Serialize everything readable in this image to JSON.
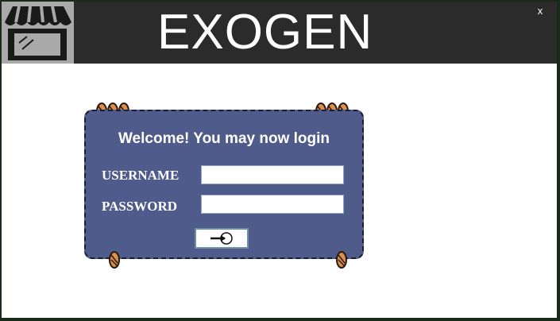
{
  "app": {
    "title": "EXOGEN",
    "close_label": "x",
    "logo_icon": "storefront-icon"
  },
  "login": {
    "welcome": "Welcome! You may now login",
    "username_label": "USERNAME",
    "username_value": "",
    "password_label": "PASSWORD",
    "password_value": "",
    "submit_icon": "login-arrow-icon"
  },
  "colors": {
    "header_bg": "#2b2b2b",
    "logo_bg": "#a9a9a9",
    "panel_bg": "#4f5b8a",
    "pin_fill": "#d98f4e"
  }
}
